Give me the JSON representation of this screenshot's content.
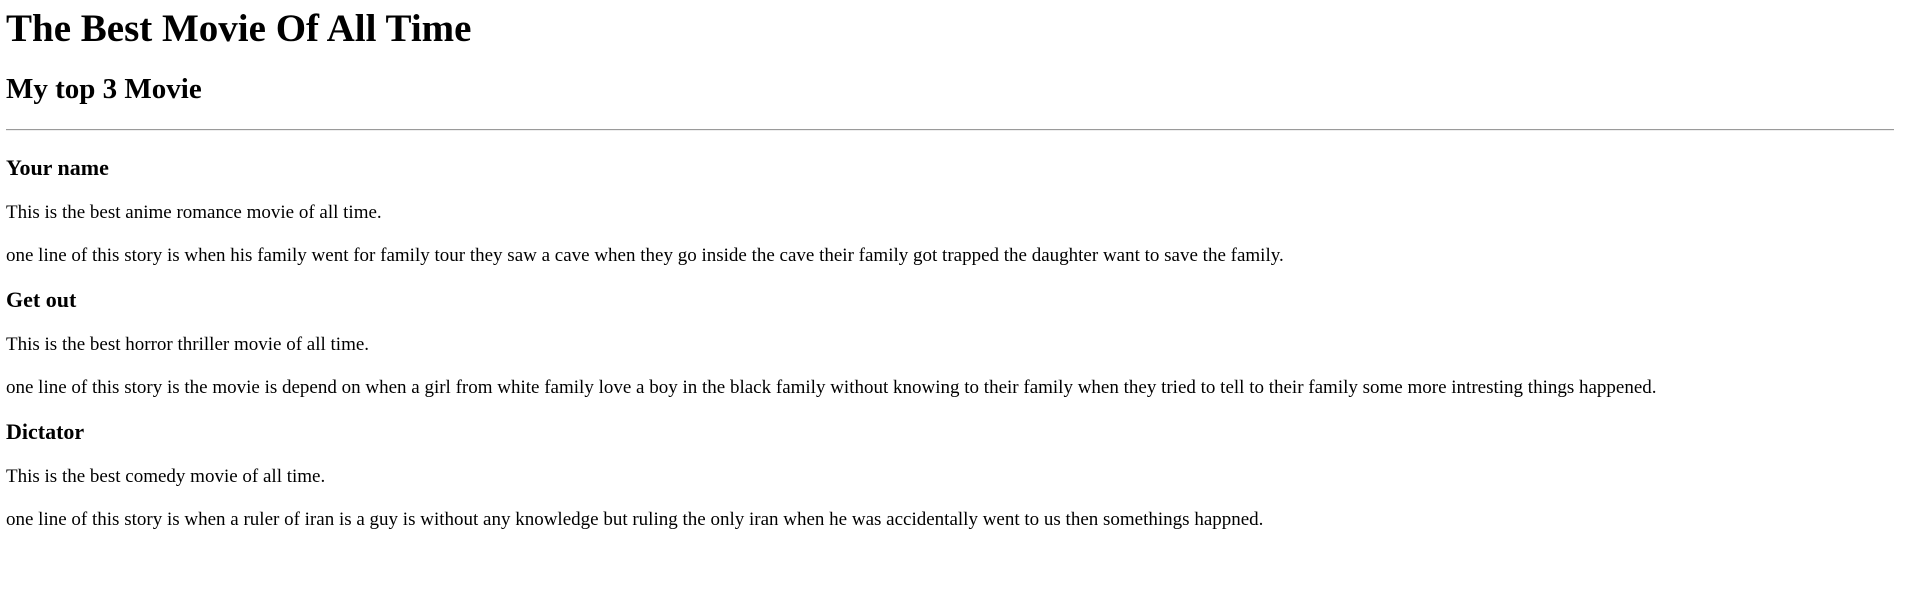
{
  "page": {
    "title": "The Best Movie Of All Time",
    "subtitle": "My top 3 Movie"
  },
  "movies": [
    {
      "name": "Your name",
      "genre": "This is the best anime romance movie of all time.",
      "story": "one line of this story is when his family went for family tour they saw a cave when they go inside the cave their family got trapped the daughter want to save the family."
    },
    {
      "name": "Get out",
      "genre": "This is the best horror thriller movie of all time.",
      "story": "one line of this story is the movie is depend on when a girl from white family love a boy in the black family without knowing to their family when they tried to tell to their family some more intresting things happened."
    },
    {
      "name": "Dictator",
      "genre": "This is the best comedy movie of all time.",
      "story": "one line of this story is when a ruler of iran is a guy is without any knowledge but ruling the only iran when he was accidentally went to us then somethings happned."
    }
  ]
}
